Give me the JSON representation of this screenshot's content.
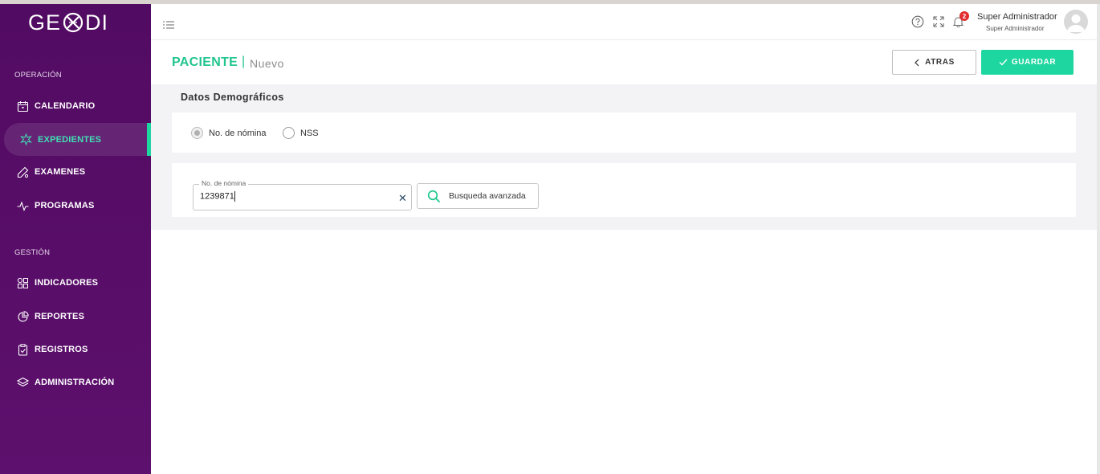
{
  "brand": {
    "logo_left": "GE",
    "logo_right": "DI",
    "accent": "#1ed69f",
    "sidebar_bg": "#5b0e6b"
  },
  "sidebar": {
    "sections": [
      {
        "title": "OPERACIÓN"
      },
      {
        "title": "GESTIÓN"
      }
    ],
    "items": [
      {
        "label": "CALENDARIO",
        "icon": "calendar-icon"
      },
      {
        "label": "EXPEDIENTES",
        "icon": "medical-icon",
        "active": true
      },
      {
        "label": "EXAMENES",
        "icon": "lab-icon"
      },
      {
        "label": "PROGRAMAS",
        "icon": "pulse-icon"
      },
      {
        "label": "INDICADORES",
        "icon": "grid-icon"
      },
      {
        "label": "REPORTES",
        "icon": "pie-chart-icon"
      },
      {
        "label": "REGISTROS",
        "icon": "clipboard-check-icon"
      },
      {
        "label": "ADMINISTRACIÓN",
        "icon": "layers-icon"
      }
    ]
  },
  "header": {
    "notifications_count": "2",
    "user_name": "Super Administrador",
    "user_role": "Super Administrador"
  },
  "page": {
    "title": "PACIENTE",
    "separator": "|",
    "subtitle": "Nuevo",
    "back_label": "ATRAS",
    "save_label": "GUARDAR"
  },
  "form": {
    "section_heading": "Datos Demográficos",
    "radios": [
      {
        "label": "No. de nómina",
        "selected": true
      },
      {
        "label": "NSS",
        "selected": false
      }
    ],
    "field_label": "No. de nómina",
    "field_value": "1239871",
    "advanced_search_label": "Busqueda avanzada"
  }
}
